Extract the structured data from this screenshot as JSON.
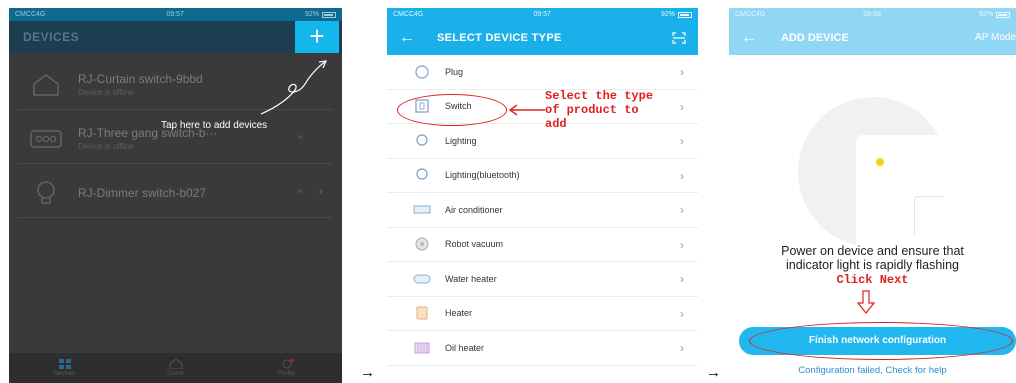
{
  "screen1": {
    "status": {
      "carrier": "CMCC4G",
      "time": "09:57",
      "battery": "92%"
    },
    "header_title": "DEVICES",
    "add_button": "+",
    "devices": [
      {
        "name": "RJ-Curtain switch-9bbd",
        "status": "Device is offline"
      },
      {
        "name": "RJ-Three gang switch-b···",
        "status": "Device is offline"
      },
      {
        "name": "RJ-Dimmer switch-b027",
        "status": ""
      }
    ],
    "hint": "Tap here to add devices",
    "tabs": [
      {
        "label": "Devices"
      },
      {
        "label": "Scene"
      },
      {
        "label": "Profile"
      }
    ]
  },
  "screen2": {
    "status": {
      "carrier": "CMCC4G",
      "time": "09:57",
      "battery": "92%"
    },
    "header_title": "SELECT DEVICE TYPE",
    "types": [
      {
        "label": "Plug",
        "icon": "plug-icon"
      },
      {
        "label": "Switch",
        "icon": "switch-icon"
      },
      {
        "label": "Lighting",
        "icon": "bulb-icon"
      },
      {
        "label": "Lighting(bluetooth)",
        "icon": "bulb-icon"
      },
      {
        "label": "Air conditioner",
        "icon": "air-conditioner-icon"
      },
      {
        "label": "Robot vacuum",
        "icon": "robot-vacuum-icon"
      },
      {
        "label": "Water heater",
        "icon": "water-heater-icon"
      },
      {
        "label": "Heater",
        "icon": "heater-icon"
      },
      {
        "label": "Oil heater",
        "icon": "oil-heater-icon"
      }
    ],
    "annotation": [
      "Select the type",
      "of product to",
      "add"
    ]
  },
  "screen3": {
    "status": {
      "carrier": "CMCC4G",
      "time": "09:58",
      "battery": "92%"
    },
    "header_title": "ADD DEVICE",
    "header_right": "AP Mode",
    "instruction_line1": "Power on device and ensure  that",
    "instruction_line2": "indicator light is rapidly flashing",
    "annotation": "Click Next",
    "finish_button": "Finish network configuration",
    "help_link": "Configuration failed,  Check for help"
  },
  "flow_arrow": "→"
}
